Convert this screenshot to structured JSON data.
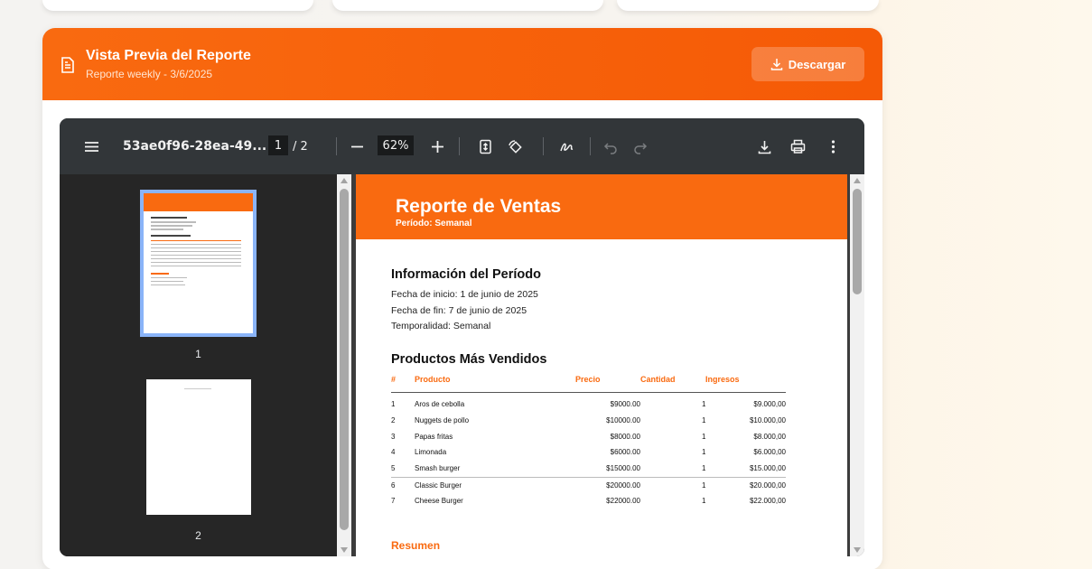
{
  "modal": {
    "title": "Vista Previa del Reporte",
    "subtitle": "Reporte weekly - 3/6/2025",
    "download_label": "Descargar"
  },
  "viewer": {
    "file_name": "53ae0f96-28ea-49...",
    "current_page": "1",
    "page_total": "/ 2",
    "zoom": "62%",
    "thumbnails": [
      {
        "label": "1"
      },
      {
        "label": "2"
      }
    ]
  },
  "report": {
    "title": "Reporte de Ventas",
    "period": "Período: Semanal",
    "info_title": "Información del Período",
    "start": "Fecha de inicio: 1 de junio de 2025",
    "end": "Fecha de fin: 7 de junio de 2025",
    "temporality": "Temporalidad: Semanal",
    "products_title": "Productos Más Vendidos",
    "columns": [
      "#",
      "Producto",
      "Precio",
      "Cantidad",
      "Ingresos"
    ],
    "rows": [
      {
        "n": "1",
        "product": "Aros de cebolla",
        "price": "$9000.00",
        "qty": "1",
        "revenue": "$9.000,00"
      },
      {
        "n": "2",
        "product": "Nuggets de pollo",
        "price": "$10000.00",
        "qty": "1",
        "revenue": "$10.000,00"
      },
      {
        "n": "3",
        "product": "Papas fritas",
        "price": "$8000.00",
        "qty": "1",
        "revenue": "$8.000,00"
      },
      {
        "n": "4",
        "product": "Limonada",
        "price": "$6000.00",
        "qty": "1",
        "revenue": "$6.000,00"
      },
      {
        "n": "5",
        "product": "Smash burger",
        "price": "$15000.00",
        "qty": "1",
        "revenue": "$15.000,00"
      },
      {
        "n": "6",
        "product": "Classic Burger",
        "price": "$20000.00",
        "qty": "1",
        "revenue": "$20.000,00"
      },
      {
        "n": "7",
        "product": "Cheese Burger",
        "price": "$22000.00",
        "qty": "1",
        "revenue": "$22.000,00"
      }
    ],
    "summary_title": "Resumen"
  },
  "colors": {
    "brand_orange": "#f96a10",
    "toolbar": "#323639",
    "viewer_bg": "#282828"
  },
  "icons": [
    "document-icon",
    "download-icon",
    "menu-icon",
    "minus-icon",
    "plus-icon",
    "fit-page-icon",
    "rotate-icon",
    "annotate-icon",
    "undo-icon",
    "redo-icon",
    "print-icon",
    "more-vert-icon"
  ]
}
